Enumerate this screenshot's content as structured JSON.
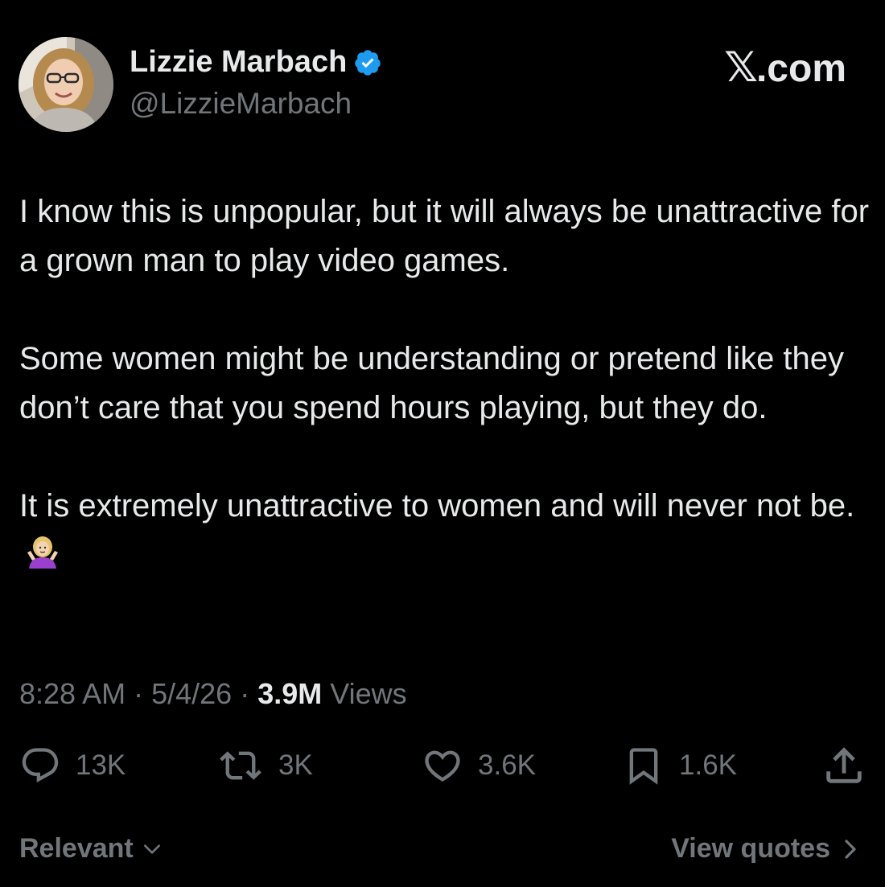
{
  "author": {
    "display_name": "Lizzie Marbach",
    "handle": "@LizzieMarbach",
    "verified_icon": "verified-badge-icon",
    "avatar_icon": "avatar-photo"
  },
  "brand": {
    "logo": "𝕏",
    "suffix": ".com"
  },
  "tweet": {
    "paragraph_1": "I know this is unpopular, but it will always be unattractive for a grown man to play video games.",
    "paragraph_2": "Some women might be understanding or pretend like they don’t care that you spend hours playing, but they do.",
    "paragraph_3": "It is extremely unattractive to women and will never not be.",
    "emoji": "🤷🏼‍♀️"
  },
  "meta": {
    "time": "8:28 AM",
    "separator": " · ",
    "date": "5/4/26",
    "views_count": "3.9M",
    "views_label": " Views"
  },
  "actions": {
    "replies": "13K",
    "reposts": "3K",
    "likes": "3.6K",
    "bookmarks": "1.6K",
    "icons": [
      "reply-icon",
      "repost-icon",
      "like-icon",
      "bookmark-icon",
      "share-icon"
    ]
  },
  "footer": {
    "sort_label": "Relevant",
    "quotes_label": "View quotes"
  },
  "colors": {
    "background": "#000000",
    "primary_text": "#e7e9ea",
    "secondary_text": "#71767b",
    "verified_blue": "#1d9bf0"
  }
}
